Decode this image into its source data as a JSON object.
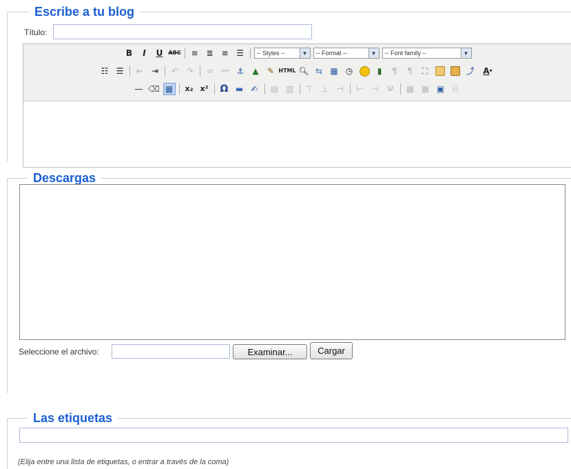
{
  "blog": {
    "legend": "Escribe a tu blog",
    "title_label": "Título:",
    "title_value": ""
  },
  "editor": {
    "toolbar": {
      "styles_select": "-- Styles --",
      "format_select": "-- Format --",
      "font_select": "-- Font family --",
      "bold": "B",
      "italic": "I",
      "underline": "U",
      "strike": "ABC",
      "html": "HTML",
      "omega": "Ω",
      "font_color": "A"
    },
    "content": ""
  },
  "downloads": {
    "legend": "Descargas",
    "file_label": "Seleccione el archivo:",
    "browse_label": "Examinar...",
    "upload_label": "Cargar"
  },
  "tags": {
    "legend": "Las etiquetas",
    "value": "",
    "hint": "(Elija entre una lista de etiquetas, o entrar a través de la coma)"
  },
  "colors": {
    "legend_text": "#1a5fd1",
    "toolbar_bg": "#f0f0ee",
    "border": "#cfcfcf"
  }
}
